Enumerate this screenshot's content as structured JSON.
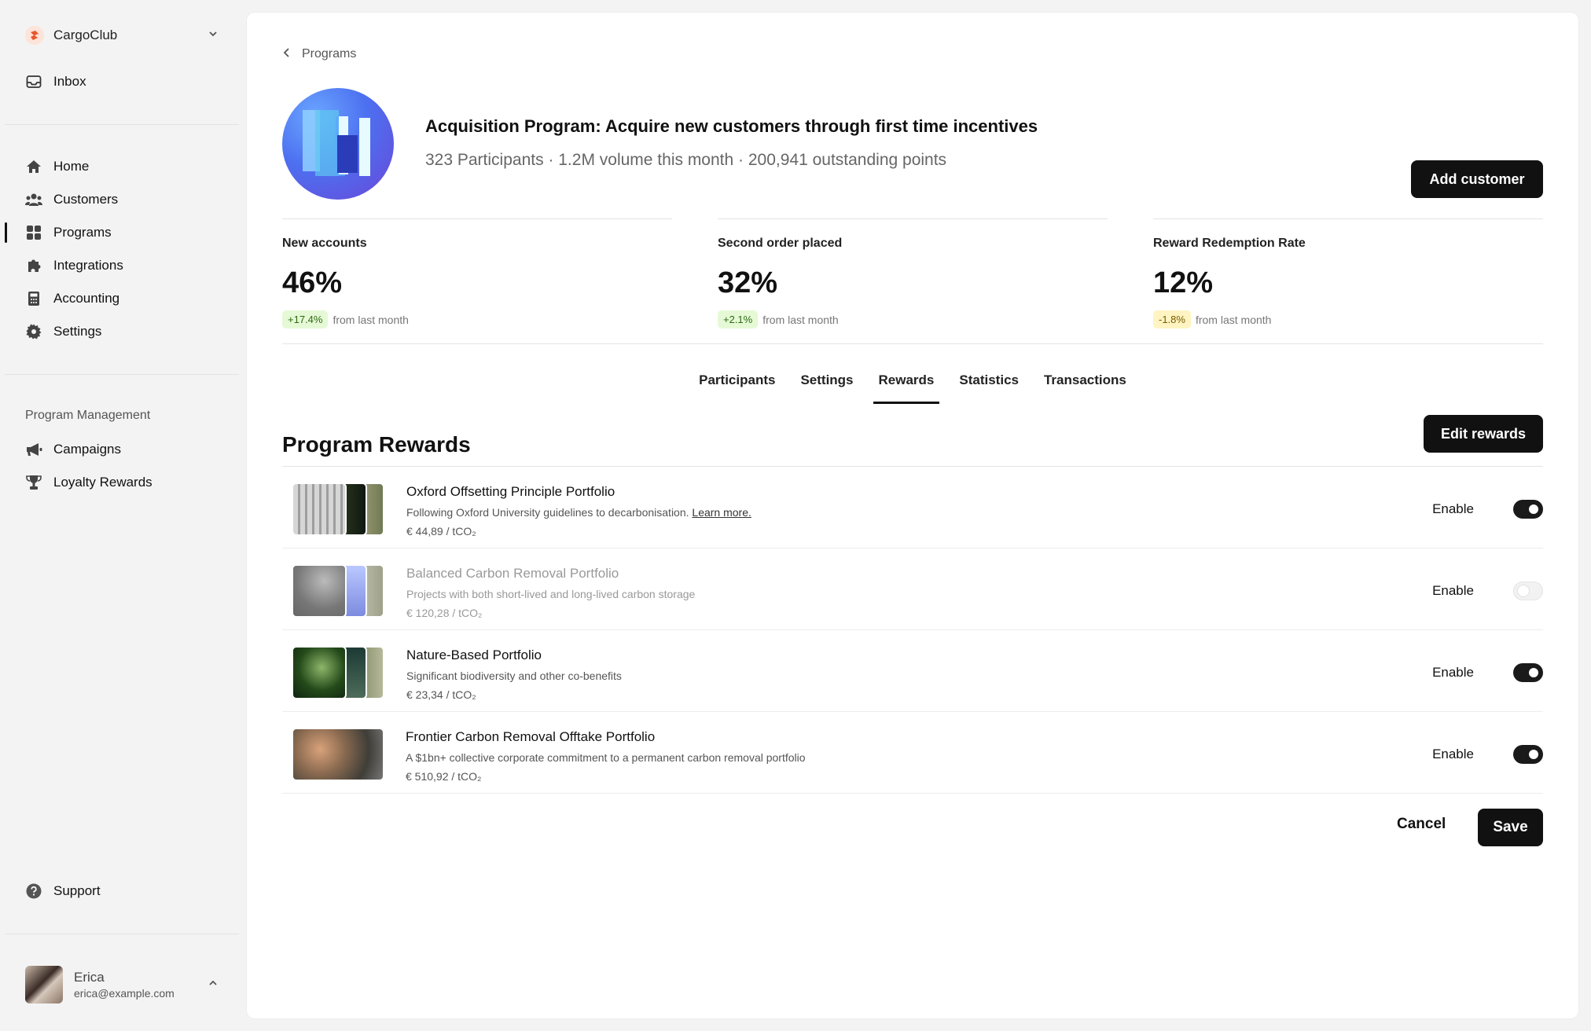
{
  "sidebar": {
    "brand": {
      "name": "CargoClub"
    },
    "inbox": {
      "label": "Inbox"
    },
    "nav": [
      {
        "label": "Home",
        "icon": "home-icon"
      },
      {
        "label": "Customers",
        "icon": "users-icon"
      },
      {
        "label": "Programs",
        "icon": "grid-icon",
        "active": true
      },
      {
        "label": "Integrations",
        "icon": "puzzle-icon"
      },
      {
        "label": "Accounting",
        "icon": "calculator-icon"
      },
      {
        "label": "Settings",
        "icon": "gear-icon"
      }
    ],
    "section_label": "Program Management",
    "management": [
      {
        "label": "Campaigns",
        "icon": "megaphone-icon"
      },
      {
        "label": "Loyalty Rewards",
        "icon": "trophy-icon"
      }
    ],
    "support": {
      "label": "Support",
      "icon": "help-icon"
    },
    "user": {
      "name": "Erica",
      "email": "erica@example.com"
    }
  },
  "header": {
    "breadcrumb": "Programs",
    "title": "Acquisition Program: Acquire new customers through first time incentives",
    "subtitle": "323 Participants · 1.2M volume this month · 200,941 outstanding points",
    "add_customer_label": "Add customer"
  },
  "stats": [
    {
      "label": "New accounts",
      "value": "46%",
      "change": "+17.4%",
      "change_tone": "positive",
      "suffix": "from last month"
    },
    {
      "label": "Second order placed",
      "value": "32%",
      "change": "+2.1%",
      "change_tone": "positive",
      "suffix": "from last month"
    },
    {
      "label": "Reward Redemption Rate",
      "value": "12%",
      "change": "-1.8%",
      "change_tone": "negative",
      "suffix": "from last month"
    }
  ],
  "tabs": [
    {
      "label": "Participants"
    },
    {
      "label": "Settings"
    },
    {
      "label": "Rewards",
      "active": true
    },
    {
      "label": "Statistics"
    },
    {
      "label": "Transactions"
    }
  ],
  "rewards_section": {
    "title": "Program Rewards",
    "edit_label": "Edit rewards",
    "items": [
      {
        "title": "Oxford Offsetting Principle Portfolio",
        "description": "Following Oxford University guidelines to decarbonisation.",
        "link": "Learn more.",
        "price": "€ 44,89 / tCO₂",
        "enable_label": "Enable",
        "enabled": true
      },
      {
        "title": "Balanced Carbon Removal Portfolio",
        "description": "Projects with both short-lived and long-lived carbon storage",
        "price": "€ 120,28 / tCO₂",
        "enable_label": "Enable",
        "enabled": false
      },
      {
        "title": "Nature-Based Portfolio",
        "description": "Significant biodiversity and other co-benefits",
        "price": "€ 23,34 / tCO₂",
        "enable_label": "Enable",
        "enabled": true
      },
      {
        "title": "Frontier Carbon Removal Offtake Portfolio",
        "description": "A $1bn+ collective corporate commitment to a permanent carbon removal portfolio",
        "price": "€ 510,92 / tCO₂",
        "enable_label": "Enable",
        "enabled": true
      }
    ],
    "cancel_label": "Cancel",
    "save_label": "Save"
  },
  "colors": {
    "accent": "#111111",
    "positive_bg": "#e6f9d6",
    "negative_bg": "#fff4c2",
    "brand": "#e8552e"
  }
}
